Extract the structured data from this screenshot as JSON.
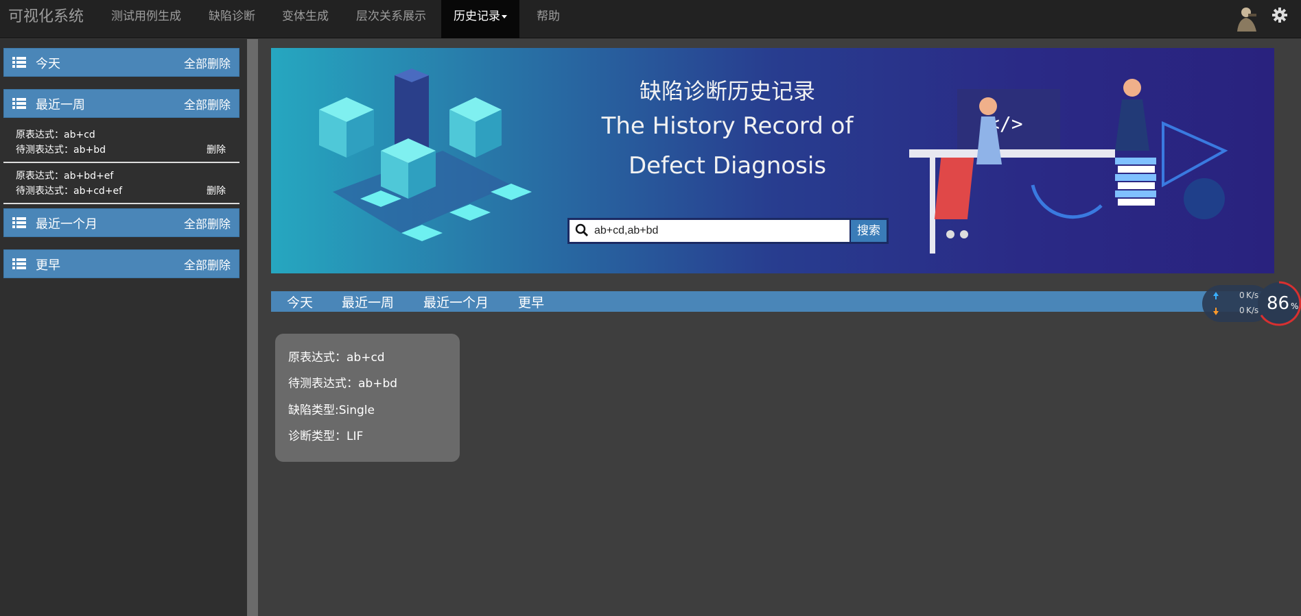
{
  "navbar": {
    "brand": "可视化系统",
    "items": [
      "测试用例生成",
      "缺陷诊断",
      "变体生成",
      "层次关系展示",
      "历史记录",
      "帮助"
    ],
    "active_index": 4
  },
  "sidebar": {
    "sections": [
      {
        "title": "今天",
        "delete_all": "全部删除",
        "items": []
      },
      {
        "title": "最近一周",
        "delete_all": "全部删除",
        "items": [
          {
            "original": "原表达式：ab+cd",
            "tested": "待测表达式：ab+bd",
            "delete": "删除"
          },
          {
            "original": "原表达式：ab+bd+ef",
            "tested": "待测表达式：ab+cd+ef",
            "delete": "删除"
          }
        ]
      },
      {
        "title": "最近一个月",
        "delete_all": "全部删除",
        "items": []
      },
      {
        "title": "更早",
        "delete_all": "全部删除",
        "items": []
      }
    ]
  },
  "banner": {
    "title": "缺陷诊断历史记录",
    "subtitle_line1": "The History Record of",
    "subtitle_line2": "Defect Diagnosis",
    "search_value": "ab+cd,ab+bd",
    "search_button": "搜索"
  },
  "tabs": [
    "今天",
    "最近一周",
    "最近一个月",
    "更早"
  ],
  "record": {
    "original": "原表达式：ab+cd",
    "tested": "待测表达式：ab+bd",
    "defect_type": "缺陷类型:Single",
    "diagnosis_type": "诊断类型：LIF"
  },
  "net_widget": {
    "up": "0",
    "down": "0",
    "unit": "K/s",
    "percent": "86",
    "percent_sign": "%"
  },
  "colors": {
    "navbar_bg": "#222222",
    "accent_blue": "#4a86b8",
    "page_bg": "#3e3e3e",
    "sidebar_bg": "#2f2f2f",
    "card_bg": "#6a6a6a"
  }
}
